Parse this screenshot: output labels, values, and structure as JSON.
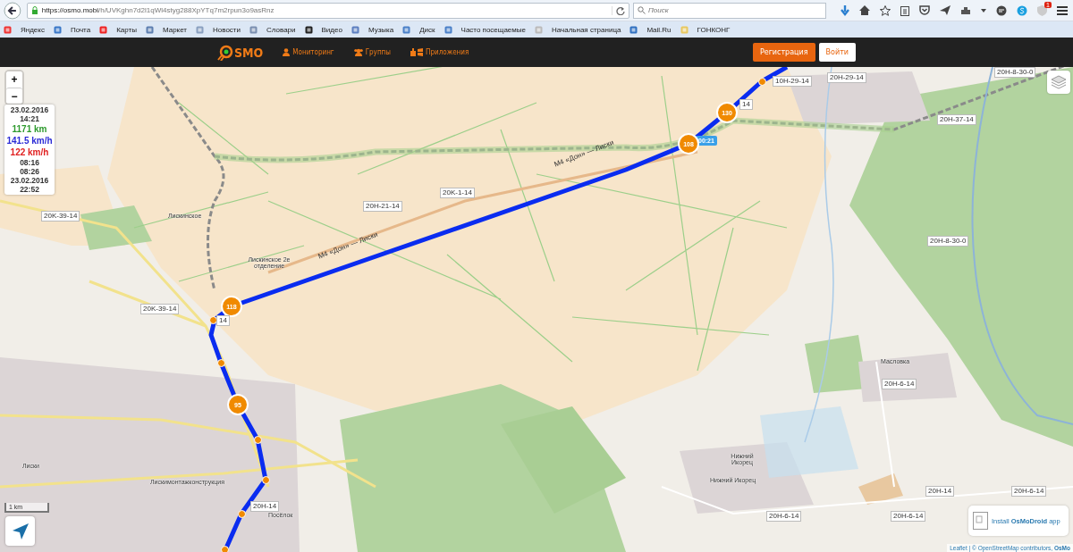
{
  "browser": {
    "url_host": "https://osmo.mobi",
    "url_path": "/h/UVKghn7d2l1qWl4styg288XpYTq7m2rpun3o9asRnz",
    "search_placeholder": "Поиск",
    "notification_count": "1"
  },
  "bookmarks": [
    "Яндекс",
    "Почта",
    "Карты",
    "Маркет",
    "Новости",
    "Словари",
    "Видео",
    "Музыка",
    "Диск",
    "Часто посещаемые",
    "Начальная страница",
    "Mail.Ru",
    "ГОНКОНГ"
  ],
  "site_nav": {
    "logo": "SMO",
    "links": [
      "Мониторинг",
      "Группы",
      "Приложения"
    ],
    "buttons": [
      {
        "label": "Регистрация",
        "kind": "primary"
      },
      {
        "label": "Войти",
        "kind": "secondary"
      }
    ]
  },
  "map": {
    "zoom": [
      "+",
      "−"
    ],
    "stats": [
      {
        "text": "23.02.2016",
        "color": "#333333"
      },
      {
        "text": "14:21",
        "color": "#333333"
      },
      {
        "text": "1171 km",
        "color": "#2e9a2e"
      },
      {
        "text": "141.5 km/h",
        "color": "#2b2bd6"
      },
      {
        "text": "122 km/h",
        "color": "#e02020"
      },
      {
        "text": "08:16",
        "color": "#333333"
      },
      {
        "text": "08:26",
        "color": "#333333"
      },
      {
        "text": "23.02.2016",
        "color": "#333333"
      },
      {
        "text": "22:52",
        "color": "#333333"
      }
    ],
    "markers": [
      "130",
      "108",
      "118",
      "95"
    ],
    "time_label": "00:21",
    "road_labels": [
      "10H-29-14",
      "20H-29-14",
      "20H-8-30-0",
      "20H-37-14",
      "14",
      "20K-1-14",
      "20H-21-14",
      "20K-39-14",
      "20K-39-14",
      "14",
      "20H-8-30-0",
      "20H-6-14",
      "20H-14",
      "20H-6-14",
      "20H-6-14",
      "20H-6-14",
      "20H-14"
    ],
    "highway_labels": [
      "M4 «Дон» — Лиски",
      "M4 «Дон» — Лиски"
    ],
    "place_labels": [
      "Лискинское",
      "Лискинское 2е отделение",
      "Масловка",
      "Нижний Икорец",
      "Нижний Икорец",
      "Лиски",
      "Лискимонтажконструкция",
      "Посёлок"
    ],
    "scale": "1 km",
    "app_banner": "Install **OsMoDroid** app",
    "attribution": "Leaflet | © OpenStreetMap contributors, **OsMo**"
  }
}
